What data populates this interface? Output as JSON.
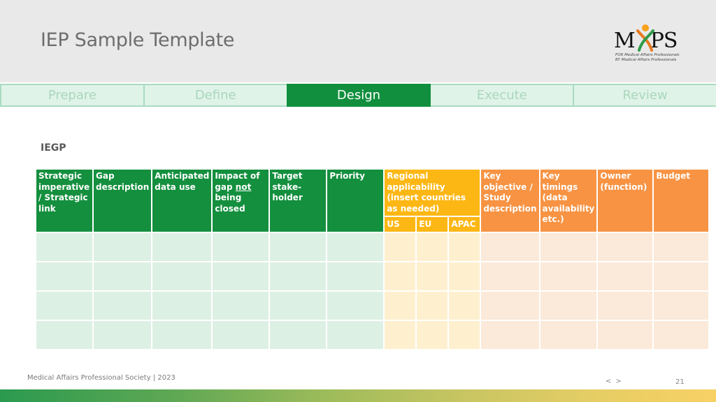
{
  "header": {
    "title": "IEP Sample Template",
    "logo": {
      "wordmark_left": "M",
      "wordmark_right": "PS",
      "tagline_line1": "FOR Medical Affairs Professionals",
      "tagline_line2": "BY Medical Affairs Professionals"
    }
  },
  "steps": [
    {
      "label": "Prepare",
      "active": false
    },
    {
      "label": "Define",
      "active": false
    },
    {
      "label": "Design",
      "active": true
    },
    {
      "label": "Execute",
      "active": false
    },
    {
      "label": "Review",
      "active": false
    }
  ],
  "section": {
    "label": "IEGP"
  },
  "table": {
    "headers": {
      "strategic": "Strategic imperative / Strategic link",
      "gap": "Gap description",
      "anticipated": "Anticipated data use",
      "impact_prefix": "Impact of gap ",
      "impact_emphasis": "not",
      "impact_suffix": " being closed",
      "target": "Target stake-holder",
      "priority": "Priority",
      "regional": "Regional applicability (insert countries as needed)",
      "region_us": "US",
      "region_eu": "EU",
      "region_apac": "APAC",
      "key_objective": "Key objective / Study description",
      "key_timings": "Key timings (data availability etc.)",
      "owner": "Owner (function)",
      "budget": "Budget"
    },
    "row_count": 4,
    "rows": [
      [
        "",
        "",
        "",
        "",
        "",
        "",
        "",
        "",
        "",
        "",
        "",
        "",
        ""
      ],
      [
        "",
        "",
        "",
        "",
        "",
        "",
        "",
        "",
        "",
        "",
        "",
        "",
        ""
      ],
      [
        "",
        "",
        "",
        "",
        "",
        "",
        "",
        "",
        "",
        "",
        "",
        "",
        ""
      ],
      [
        "",
        "",
        "",
        "",
        "",
        "",
        "",
        "",
        "",
        "",
        "",
        "",
        ""
      ]
    ],
    "colors": {
      "green_header": "#148f3e",
      "yellow_header": "#fdb714",
      "orange_header": "#f79343",
      "green_body": "#ddf0e4",
      "yellow_body": "#fef0cf",
      "orange_body": "#fbe9d9"
    }
  },
  "footer": {
    "org": "Medical Affairs Professional Society | 2023",
    "prev": "<",
    "next": ">",
    "page_number": "21"
  }
}
